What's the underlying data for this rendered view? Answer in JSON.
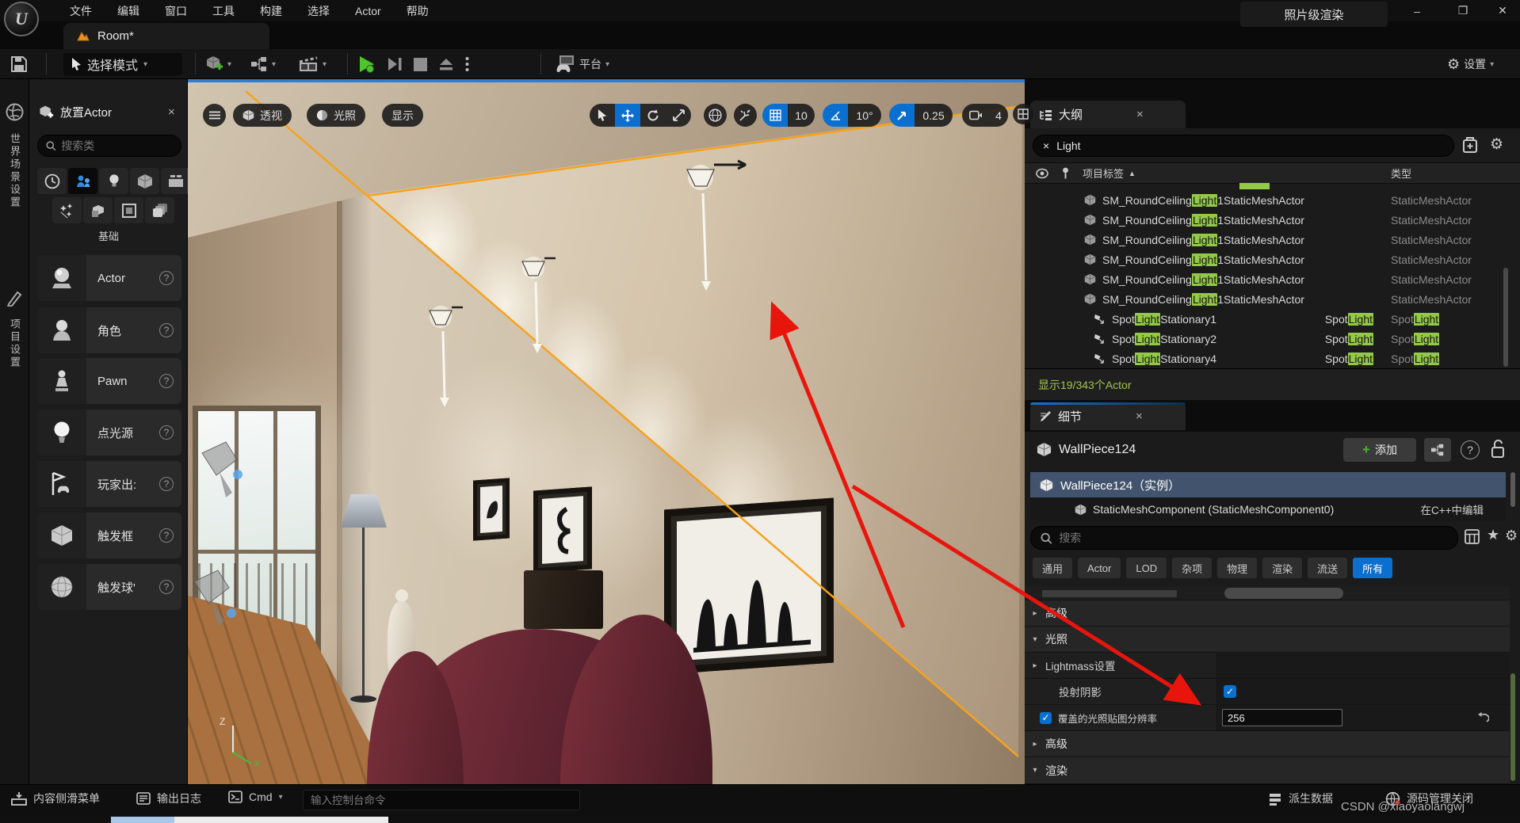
{
  "colors": {
    "accent_blue": "#0b6fd0",
    "highlight_green": "#94c947",
    "selection_orange": "#f6a21d",
    "annotation_red": "#e8150d"
  },
  "window": {
    "render_badge": "照片级渲染",
    "minimize": "–",
    "maximize": "❐",
    "close": "✕",
    "logo": "U"
  },
  "menu": {
    "items": [
      "文件",
      "编辑",
      "窗口",
      "工具",
      "构建",
      "选择",
      "Actor",
      "帮助"
    ]
  },
  "tab": {
    "title": "Room*"
  },
  "toolbar": {
    "mode_label": "选择模式",
    "platform_label": "平台",
    "settings_label": "设置"
  },
  "left_rail": {
    "world_settings": "世界场景设置",
    "project_settings": "项目设置"
  },
  "place_panel": {
    "title": "放置Actor",
    "search_placeholder": "搜索类",
    "category_label": "基础",
    "items": [
      "Actor",
      "角色",
      "Pawn",
      "点光源",
      "玩家出:",
      "触发框",
      "触发球'"
    ]
  },
  "viewport": {
    "perspective": "透视",
    "lit": "光照",
    "show": "显示",
    "grid_snap": "10",
    "angle_snap": "10°",
    "scale_snap": "0.25",
    "camera_speed": "4",
    "axis_up": "Z",
    "axis_x": "x"
  },
  "outliner": {
    "tab": "大纲",
    "search_value": "Light",
    "col_label": "项目标签",
    "col_sort": "▲",
    "col_type": "类型",
    "status": "显示19/343个Actor",
    "rows": [
      {
        "pre": "SM_RoundCeiling",
        "hl": "Light",
        "post": "1StaticMeshActor",
        "xpre": "",
        "xhl": "",
        "type": "StaticMeshActor",
        "thl": ""
      },
      {
        "pre": "SM_RoundCeiling",
        "hl": "Light",
        "post": "1StaticMeshActor",
        "xpre": "",
        "xhl": "",
        "type": "StaticMeshActor",
        "thl": ""
      },
      {
        "pre": "SM_RoundCeiling",
        "hl": "Light",
        "post": "1StaticMeshActor",
        "xpre": "",
        "xhl": "",
        "type": "StaticMeshActor",
        "thl": ""
      },
      {
        "pre": "SM_RoundCeiling",
        "hl": "Light",
        "post": "1StaticMeshActor",
        "xpre": "",
        "xhl": "",
        "type": "StaticMeshActor",
        "thl": ""
      },
      {
        "pre": "SM_RoundCeiling",
        "hl": "Light",
        "post": "1StaticMeshActor",
        "xpre": "",
        "xhl": "",
        "type": "StaticMeshActor",
        "thl": ""
      },
      {
        "pre": "SM_RoundCeiling",
        "hl": "Light",
        "post": "1StaticMeshActor",
        "xpre": "",
        "xhl": "",
        "type": "StaticMeshActor",
        "thl": ""
      },
      {
        "pre": "Spot",
        "hl": "Light",
        "post": "Stationary1",
        "xpre": "Spot",
        "xhl": "Light",
        "type": "Spot",
        "thl": "Light"
      },
      {
        "pre": "Spot",
        "hl": "Light",
        "post": "Stationary2",
        "xpre": "Spot",
        "xhl": "Light",
        "type": "Spot",
        "thl": "Light"
      },
      {
        "pre": "Spot",
        "hl": "Light",
        "post": "Stationary4",
        "xpre": "Spot",
        "xhl": "Light",
        "type": "Spot",
        "thl": "Light"
      }
    ]
  },
  "details": {
    "tab": "细节",
    "object_name": "WallPiece124",
    "add_label": "添加",
    "instance_row": "WallPiece124（实例）",
    "component_row": "StaticMeshComponent (StaticMeshComponent0)",
    "component_edit": "在C++中编辑",
    "search_placeholder": "搜索",
    "filters": [
      "通用",
      "Actor",
      "LOD",
      "杂项",
      "物理",
      "渲染",
      "流送",
      "所有"
    ],
    "sections": {
      "advanced1": "高级",
      "lighting": "光照",
      "lightmass": "Lightmass设置",
      "cast_shadow": "投射阴影",
      "override_res": "覆盖的光照贴图分辨率",
      "advanced2": "高级",
      "rendering": "渲染"
    },
    "res_value": "256",
    "check_glyph": "✓"
  },
  "statusbar": {
    "content_drawer": "内容侧滑菜单",
    "output_log": "输出日志",
    "cmd": "Cmd",
    "console_placeholder": "输入控制台命令",
    "derived_data": "派生数据",
    "source_control": "源码管理关闭",
    "watermark": "CSDN @xiaoyaolangwj"
  }
}
